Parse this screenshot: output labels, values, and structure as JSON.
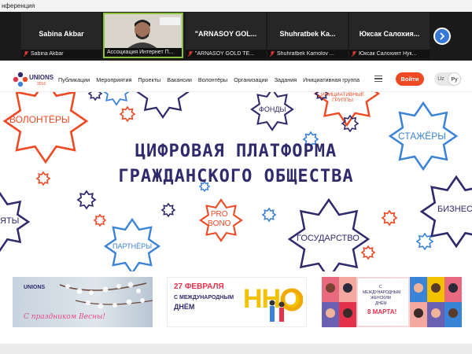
{
  "window": {
    "title": "нференция"
  },
  "conference": {
    "participants": [
      {
        "display": "Sabina Akbar",
        "label": "Sabina Akbar",
        "active": false
      },
      {
        "display": "",
        "label": "Ассоциация Интернет П...",
        "active": true
      },
      {
        "display": "\"ARNASOY GOL...",
        "label": "\"ARNASOY GOLD TE...",
        "active": false
      },
      {
        "display": "Shuhratbek Ka...",
        "label": "Shuhratbek Kamolov ...",
        "active": false
      },
      {
        "display": "Юксак Салохия...",
        "label": "Юксак Салохият Нук...",
        "active": false
      }
    ],
    "next_icon": "chevron-right-icon"
  },
  "site": {
    "logo_text": "UNIONS",
    "logo_sub": "2016",
    "nav": [
      "Публикации",
      "Мероприятия",
      "Проекты",
      "Вакансии",
      "Волонтёры",
      "Организации",
      "Задания",
      "Инициативная группа"
    ],
    "login": "Войти",
    "lang_uz": "Uz",
    "lang_ru": "Ру"
  },
  "hero": {
    "title_line1": "ЦИФРОВАЯ ПЛАТФОРМА",
    "title_line2": "ГРАЖДАНСКОГО ОБЩЕСТВА",
    "labels": {
      "volunteers": "ВОЛОНТЁРЫ",
      "initiative": "ИНИЦИАТИВНЫЕ\nГРУППЫ",
      "funds": "ФОНДЫ",
      "interns": "СТАЖЁРЫ",
      "business": "БИЗНЕС",
      "state": "ГОСУДАРСТВО",
      "probono": "PRO\nBONO",
      "partners": "ПАРТНЁРЫ",
      "left_cut": "ЯТЫ"
    },
    "colors": {
      "navy": "#2f2a6b",
      "orange": "#ef4a23",
      "blue": "#3b83d8"
    }
  },
  "banners": [
    {
      "logo": "UNIONS",
      "text": "С праздником Весны!"
    },
    {
      "date_line1": "27 ФЕВРАЛЯ",
      "date_line2": "С МЕЖДУНАРОДНЫМ",
      "date_line3": "ДНЁМ",
      "letters": "ННО"
    },
    {
      "line1": "С",
      "line2": "МЕЖДУНАРОДНЫМ",
      "line3": "ЖЕНСКИМ",
      "line4": "ДНЁМ",
      "line5": "8 МАРТА!"
    }
  ]
}
